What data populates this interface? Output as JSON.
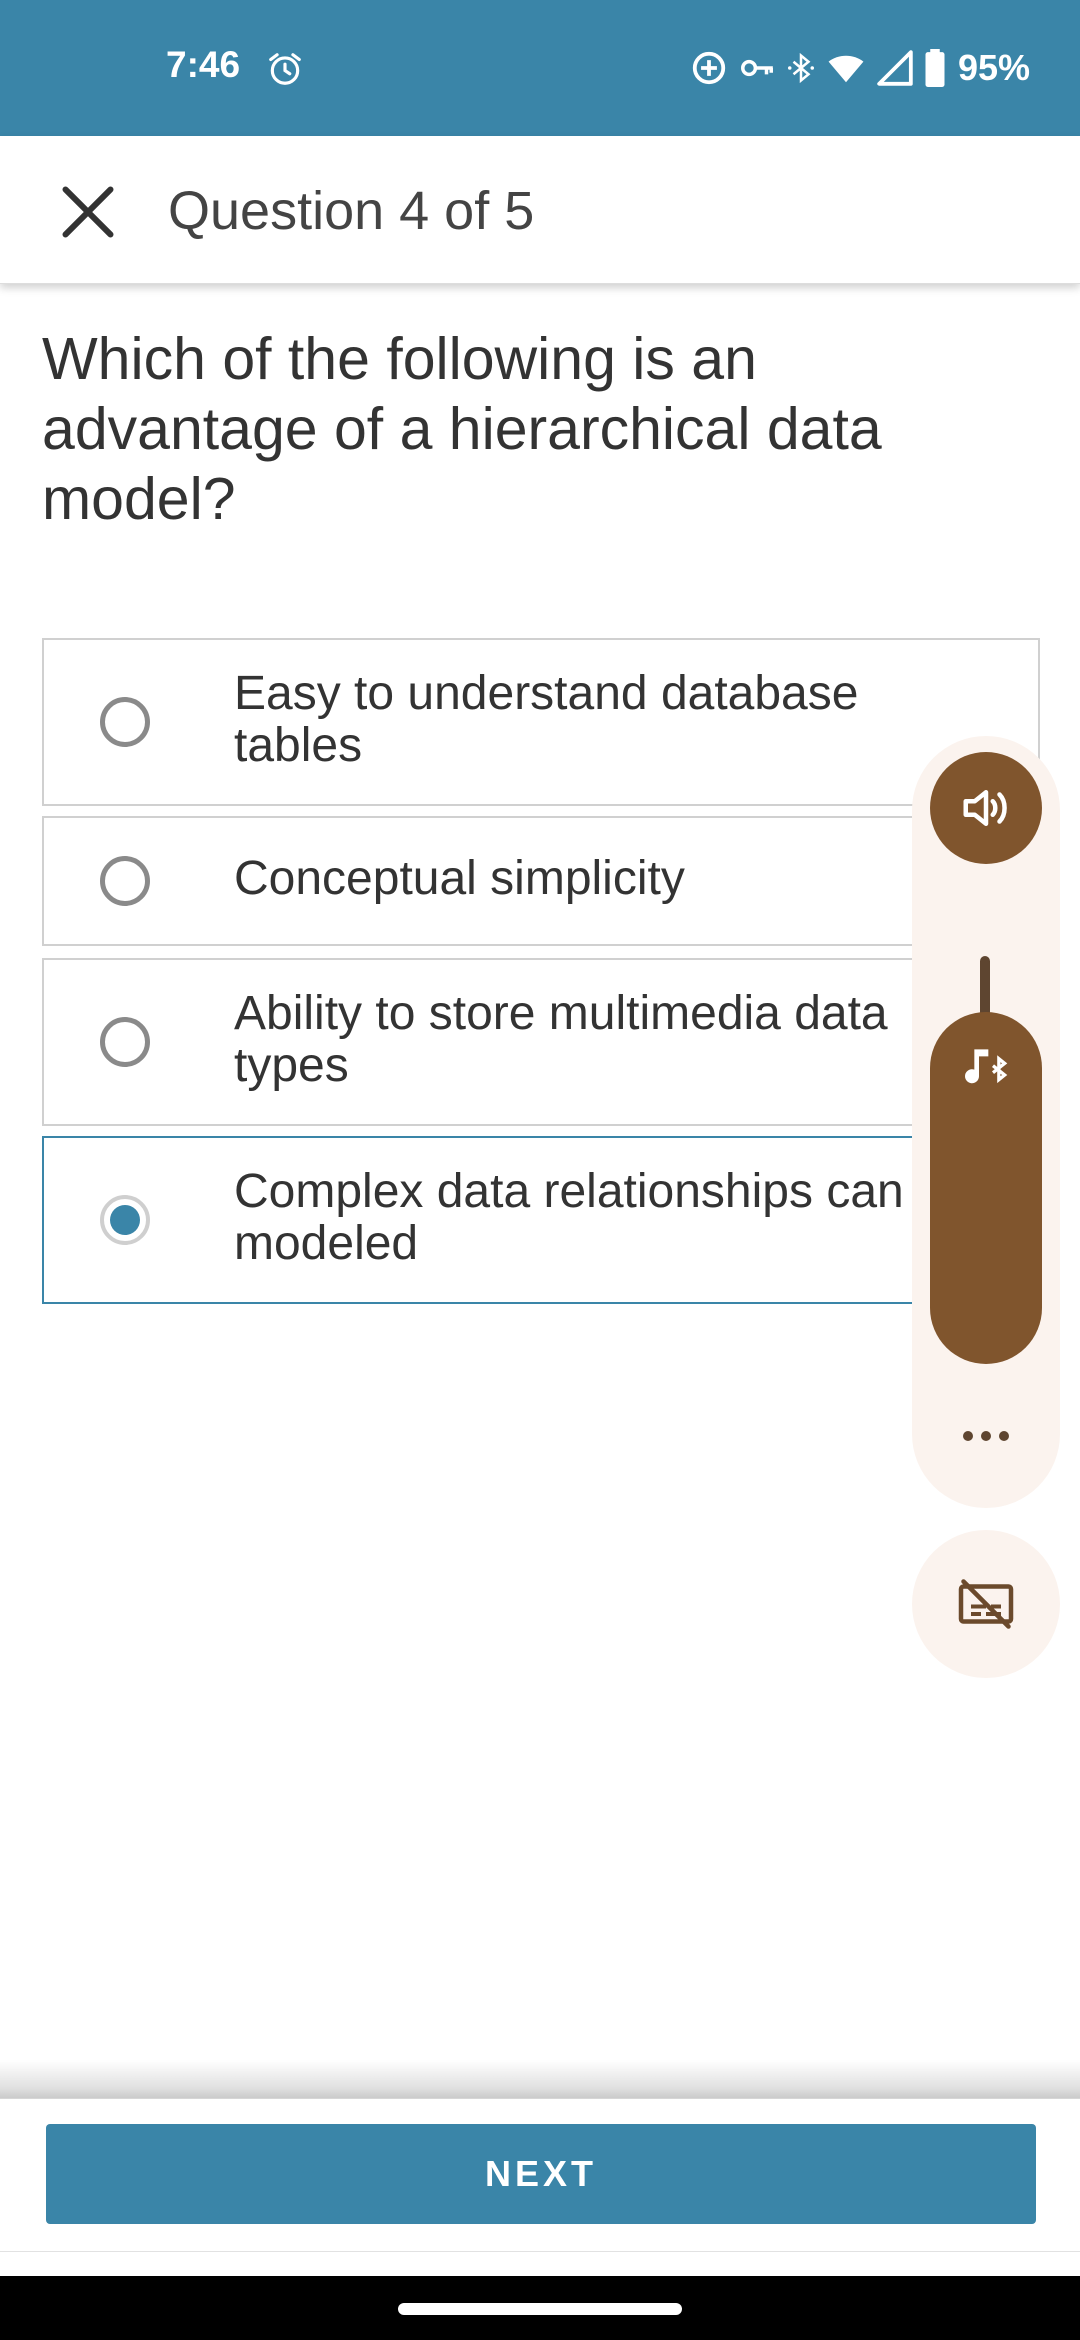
{
  "status_bar": {
    "time": "7:46",
    "battery": "95%",
    "icons": [
      "alarm-icon",
      "data-saver-icon",
      "vpn-key-icon",
      "bluetooth-icon",
      "wifi-icon",
      "signal-icon",
      "battery-icon"
    ]
  },
  "header": {
    "title": "Question 4 of 5",
    "close_icon": "close-icon"
  },
  "question": {
    "text": "Which of the following is an advantage of a hierarchical data model?"
  },
  "options": [
    {
      "line1": "Easy to understand database",
      "line2": "tables",
      "selected": false
    },
    {
      "line1": "Conceptual simplicity",
      "line2": "",
      "selected": false
    },
    {
      "line1": "Ability to store multimedia data",
      "line2": "types",
      "selected": false
    },
    {
      "line1": "Complex data relationships can be",
      "line2": "modeled",
      "selected": true
    }
  ],
  "volume_overlay": {
    "icons": [
      "speaker-icon",
      "music-bluetooth-icon",
      "more-icon",
      "captions-off-icon"
    ],
    "accent_color": "#80552d"
  },
  "footer": {
    "next_label": "NEXT"
  },
  "colors": {
    "primary": "#3a85a8",
    "text": "#333333",
    "border": "#d0d0d0"
  }
}
